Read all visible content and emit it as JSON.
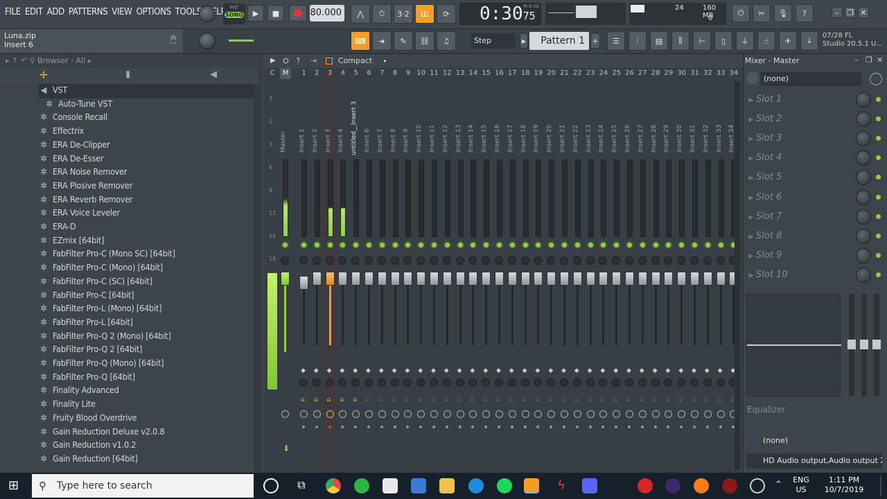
{
  "menu": [
    "FILE",
    "EDIT",
    "ADD",
    "PATTERNS",
    "VIEW",
    "OPTIONS",
    "TOOLS",
    "HELP"
  ],
  "transport": {
    "pat_label": "PAT",
    "song_label": "SONG",
    "tempo": "80.000",
    "time_main": "0:30",
    "time_sub": "75",
    "time_unit": "M:S:CS"
  },
  "meters": {
    "cpu": "24",
    "memory": "160 MB",
    "poly": "0"
  },
  "hint": {
    "line1": "Luna.zip",
    "line2": "Insert 6"
  },
  "pattern": {
    "snap": "Step",
    "name": "Pattern 1"
  },
  "news": {
    "date": "07/28",
    "line1": "FL",
    "line2": "Studio 20.5.1 U..."
  },
  "browser": {
    "header": "Browser - All",
    "items": [
      "VST",
      "Auto-Tune VST",
      "Console Recall",
      "Effectrix",
      "ERA De-Clipper",
      "ERA De-Esser",
      "ERA Noise Remover",
      "ERA Plosive Remover",
      "ERA Reverb Remover",
      "ERA Voice Leveler",
      "ERA-D",
      "EZmix [64bit]",
      "FabFilter Pro-C (Mono SC) [64bit]",
      "FabFilter Pro-C (Mono) [64bit]",
      "FabFilter Pro-C (SC) [64bit]",
      "FabFilter Pro-C [64bit]",
      "FabFilter Pro-L (Mono) [64bit]",
      "FabFilter Pro-L [64bit]",
      "FabFilter Pro-Q 2 (Mono) [64bit]",
      "FabFilter Pro-Q 2 [64bit]",
      "FabFilter Pro-Q (Mono) [64bit]",
      "FabFilter Pro-Q [64bit]",
      "Finality Advanced",
      "Finality Lite",
      "Fruity Blood Overdrive",
      "Gain Reduction Deluxe v2.0.8",
      "Gain Reduction v1.0.2",
      "Gain Reduction [64bit]"
    ]
  },
  "mixer": {
    "view_label": "Compact",
    "cm_labels": [
      "C",
      "M"
    ],
    "db_ticks": [
      "3",
      "0",
      "3",
      "6",
      "9",
      "12",
      "15",
      "18"
    ],
    "master_label": "Master",
    "strips": [
      {
        "num": "1",
        "name": "Insert 1"
      },
      {
        "num": "2",
        "name": "Insert 2"
      },
      {
        "num": "3",
        "name": "Insert 3"
      },
      {
        "num": "4",
        "name": "Insert 4"
      },
      {
        "num": "5",
        "name": "untitled__Insert 3"
      },
      {
        "num": "6",
        "name": "Insert 6"
      },
      {
        "num": "7",
        "name": "Insert 7"
      },
      {
        "num": "8",
        "name": "Insert 8"
      },
      {
        "num": "9",
        "name": "Insert 9"
      },
      {
        "num": "10",
        "name": "Insert 10"
      },
      {
        "num": "11",
        "name": "Insert 11"
      },
      {
        "num": "12",
        "name": "Insert 12"
      },
      {
        "num": "13",
        "name": "Insert 13"
      },
      {
        "num": "14",
        "name": "Insert 14"
      },
      {
        "num": "15",
        "name": "Insert 15"
      },
      {
        "num": "16",
        "name": "Insert 16"
      },
      {
        "num": "17",
        "name": "Insert 17"
      },
      {
        "num": "18",
        "name": "Insert 18"
      },
      {
        "num": "19",
        "name": "Insert 19"
      },
      {
        "num": "20",
        "name": "Insert 20"
      },
      {
        "num": "21",
        "name": "Insert 21"
      },
      {
        "num": "22",
        "name": "Insert 22"
      },
      {
        "num": "23",
        "name": "Insert 23"
      },
      {
        "num": "24",
        "name": "Insert 24"
      },
      {
        "num": "25",
        "name": "Insert 25"
      },
      {
        "num": "26",
        "name": "Insert 26"
      },
      {
        "num": "27",
        "name": "Insert 27"
      },
      {
        "num": "28",
        "name": "Insert 28"
      },
      {
        "num": "29",
        "name": "Insert 29"
      },
      {
        "num": "30",
        "name": "Insert 30"
      },
      {
        "num": "31",
        "name": "Insert 31"
      },
      {
        "num": "32",
        "name": "Insert 32"
      },
      {
        "num": "33",
        "name": "Insert 33"
      },
      {
        "num": "34",
        "name": "Insert 34"
      }
    ]
  },
  "panel": {
    "title": "Mixer - Master",
    "preset": "(none)",
    "slots": [
      "Slot 1",
      "Slot 2",
      "Slot 3",
      "Slot 4",
      "Slot 5",
      "Slot 6",
      "Slot 7",
      "Slot 8",
      "Slot 9",
      "Slot 10"
    ],
    "eq_label": "Equalizer",
    "input": "(none)",
    "output": "HD Audio output,Audio output 2"
  },
  "taskbar": {
    "search_placeholder": "Type here to search",
    "lang1": "ENG",
    "lang2": "US",
    "time": "1:11 PM",
    "date": "10/7/2019"
  },
  "colors": {
    "accent_green": "#8fd043",
    "accent_orange": "#f29f2a",
    "record_red": "#d83b3b"
  }
}
